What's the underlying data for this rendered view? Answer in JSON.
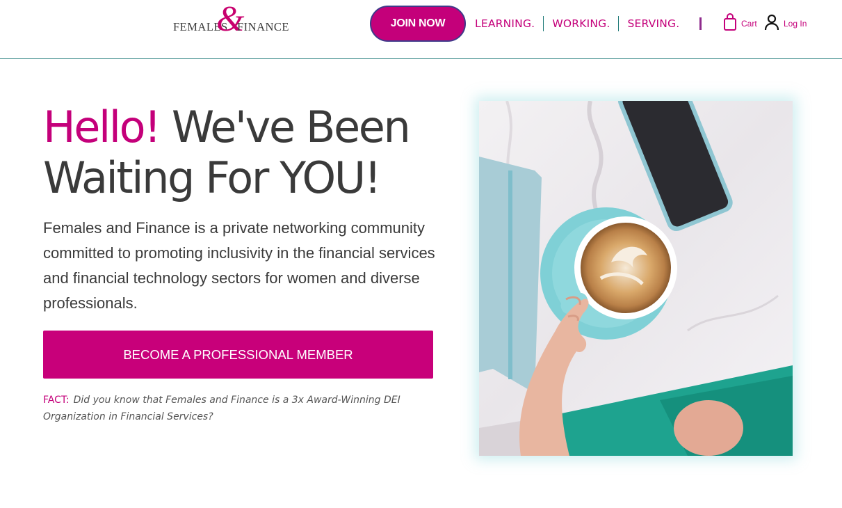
{
  "header": {
    "logo": {
      "word_left": "FEMALES",
      "ampersand": "&",
      "word_right": "FINANCE"
    },
    "join_button": "JOIN NOW",
    "nav": [
      {
        "label": "LEARNING."
      },
      {
        "label": "WORKING."
      },
      {
        "label": "SERVING."
      }
    ],
    "cart_label": "Cart",
    "login_label": "Log In"
  },
  "hero": {
    "headline_accent": "Hello!",
    "headline_rest": " We've Been Waiting For YOU!",
    "description": "Females and Finance is a private networking community committed to promoting inclusivity in the financial services and financial technology sectors for women and diverse professionals.",
    "cta_label": "BECOME A PROFESSIONAL MEMBER",
    "fact_label": "FACT:",
    "fact_text": "Did you know that Females and Finance is a 3x Award-Winning DEI Organization in Financial Services?"
  },
  "icons": {
    "cart": "shopping-bag-icon",
    "login": "user-icon"
  },
  "colors": {
    "brand_magenta": "#c4007a",
    "text_dark": "#3a3a3a",
    "divider_teal": "#1f7a78"
  }
}
